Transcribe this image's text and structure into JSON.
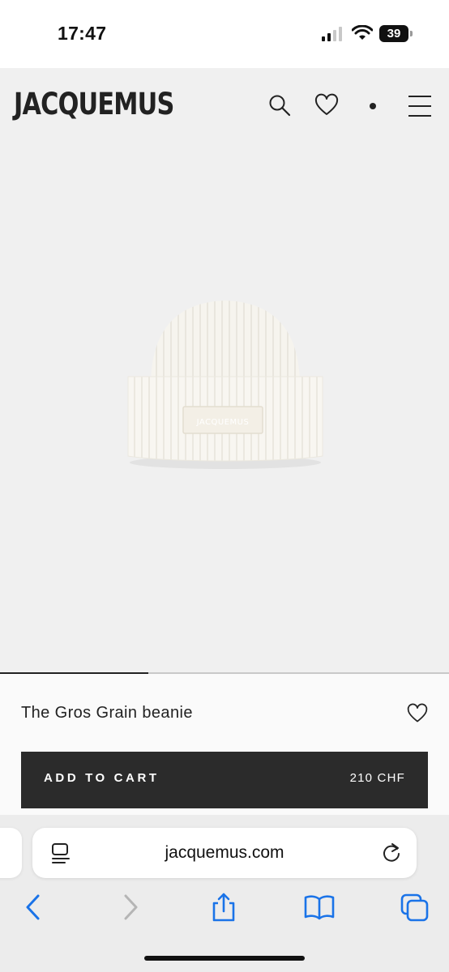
{
  "status_bar": {
    "time": "17:47",
    "battery_percent": "39",
    "signal_icon": "cellular-signal-icon",
    "wifi_icon": "wifi-icon"
  },
  "header": {
    "logo": "JACQUEMUS",
    "icons": [
      "search-icon",
      "heart-icon",
      "dot-icon",
      "hamburger-menu-icon"
    ]
  },
  "gallery": {
    "image": "cream ribbed knit beanie with tone-on-tone JACQUEMUS patch",
    "patch_text": "JACQUEMUS",
    "progress_fraction": 0.33
  },
  "product": {
    "name": "The Gros Grain beanie",
    "add_to_cart_label": "ADD TO CART",
    "price": "210 CHF"
  },
  "browser": {
    "url": "jacquemus.com",
    "toolbar_icons": [
      "back-icon",
      "forward-icon",
      "share-icon",
      "bookmarks-icon",
      "tabs-icon"
    ]
  },
  "colors": {
    "accent": "#2b2b2b",
    "toolbar_blue": "#1a73e8",
    "page_background": "#f0f0f0"
  }
}
